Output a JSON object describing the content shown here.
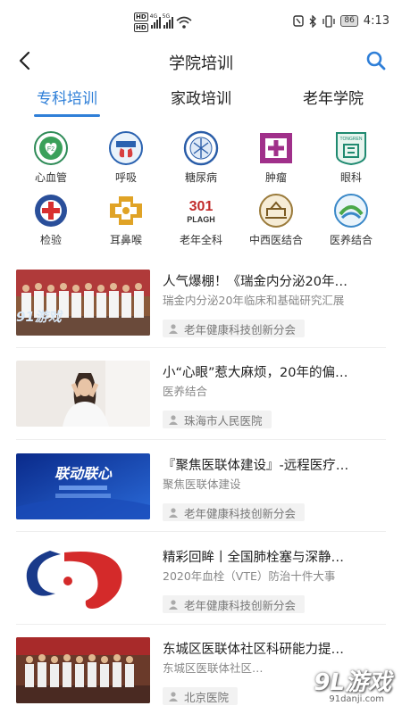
{
  "status_bar": {
    "hd1": "HD",
    "hd2": "HD",
    "net1": "4G",
    "net2": "5G",
    "battery": "86",
    "time": "4:13"
  },
  "header": {
    "title": "学院培训"
  },
  "tabs": [
    {
      "label": "专科培训",
      "active": true
    },
    {
      "label": "家政培训",
      "active": false
    },
    {
      "label": "老年学院",
      "active": false
    }
  ],
  "categories": [
    {
      "label": "心血管",
      "icon": "cardiovascular-logo-icon"
    },
    {
      "label": "呼吸",
      "icon": "respiratory-logo-icon"
    },
    {
      "label": "糖尿病",
      "icon": "diabetes-logo-icon"
    },
    {
      "label": "肿瘤",
      "icon": "oncology-logo-icon"
    },
    {
      "label": "眼科",
      "icon": "ophthalmology-logo-icon"
    },
    {
      "label": "检验",
      "icon": "laboratory-logo-icon"
    },
    {
      "label": "耳鼻喉",
      "icon": "ent-logo-icon"
    },
    {
      "label": "老年全科",
      "icon": "geriatric-plagh-logo-icon"
    },
    {
      "label": "中西医结合",
      "icon": "integrated-medicine-logo-icon"
    },
    {
      "label": "医养结合",
      "icon": "medical-care-logo-icon"
    }
  ],
  "icon_texts": {
    "ophthalmology": "TONGREN",
    "geriatric": "PLAGH",
    "geriatric_num": "301"
  },
  "news": [
    {
      "title": "人气爆棚！《瑞金内分泌20年…",
      "subtitle": "瑞金内分泌20年临床和基础研究汇展",
      "tag": "老年健康科技创新分会"
    },
    {
      "title": "小“心眼”惹大麻烦，20年的偏…",
      "subtitle": "医养结合",
      "tag": "珠海市人民医院"
    },
    {
      "title": "『聚焦医联体建设』-远程医疗…",
      "subtitle": "聚焦医联体建设",
      "tag": "老年健康科技创新分会",
      "thumb_text": "联动联心"
    },
    {
      "title": "精彩回眸丨全国肺栓塞与深静…",
      "subtitle": "2020年血栓（VTE）防治十件大事",
      "tag": "老年健康科技创新分会"
    },
    {
      "title": "东城区医联体社区科研能力提…",
      "subtitle": "东城区医联体社区…",
      "tag": "北京医院"
    }
  ],
  "watermark": {
    "thumb": "91游戏",
    "corner": "9L游戏",
    "url": "91danji.com"
  },
  "colors": {
    "accent": "#2f7fd8",
    "text": "#222222",
    "muted": "#888888",
    "tag_bg": "#f2f2f2"
  }
}
